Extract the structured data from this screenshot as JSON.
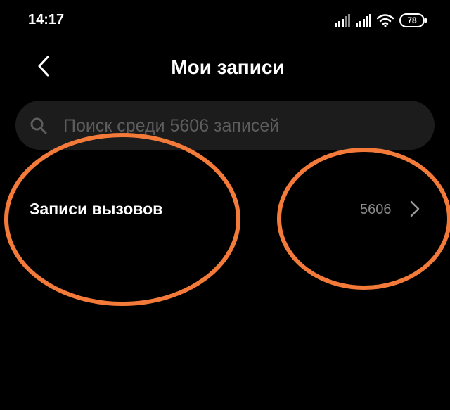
{
  "status_bar": {
    "time": "14:17",
    "battery": "78",
    "icons": [
      "signal-icon",
      "signal-icon",
      "wifi-icon",
      "battery-icon"
    ]
  },
  "header": {
    "title": "Мои записи",
    "back_icon": "chevron-left-icon"
  },
  "search": {
    "placeholder": "Поиск среди 5606 записей",
    "value": "",
    "icon": "search-icon"
  },
  "list": {
    "items": [
      {
        "label": "Записи вызовов",
        "count": "5606",
        "icon": "chevron-right-icon"
      }
    ]
  },
  "colors": {
    "background": "#000000",
    "text": "#ffffff",
    "muted": "#8a8a8a",
    "search_bg": "#1c1c1c",
    "annotation": "#f47a3a"
  }
}
